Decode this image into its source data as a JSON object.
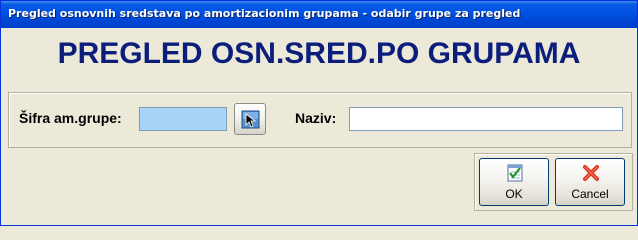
{
  "window": {
    "title": "Pregled osnovnih sredstava po amortizacionim grupama - odabir grupe za pregled"
  },
  "header": {
    "title": "PREGLED OSN.SRED.PO GRUPAMA"
  },
  "form": {
    "sifra_label": "Šifra am.grupe:",
    "sifra_value": "",
    "naziv_label": "Naziv:",
    "naziv_value": ""
  },
  "buttons": {
    "ok_label": "OK",
    "cancel_label": "Cancel"
  },
  "icons": {
    "lookup": "arrow-pointer-icon",
    "ok": "checklist-icon",
    "cancel": "red-x-icon"
  },
  "colors": {
    "title_text": "#0b1e7c",
    "sifra_field_bg": "#a8d4f8"
  }
}
